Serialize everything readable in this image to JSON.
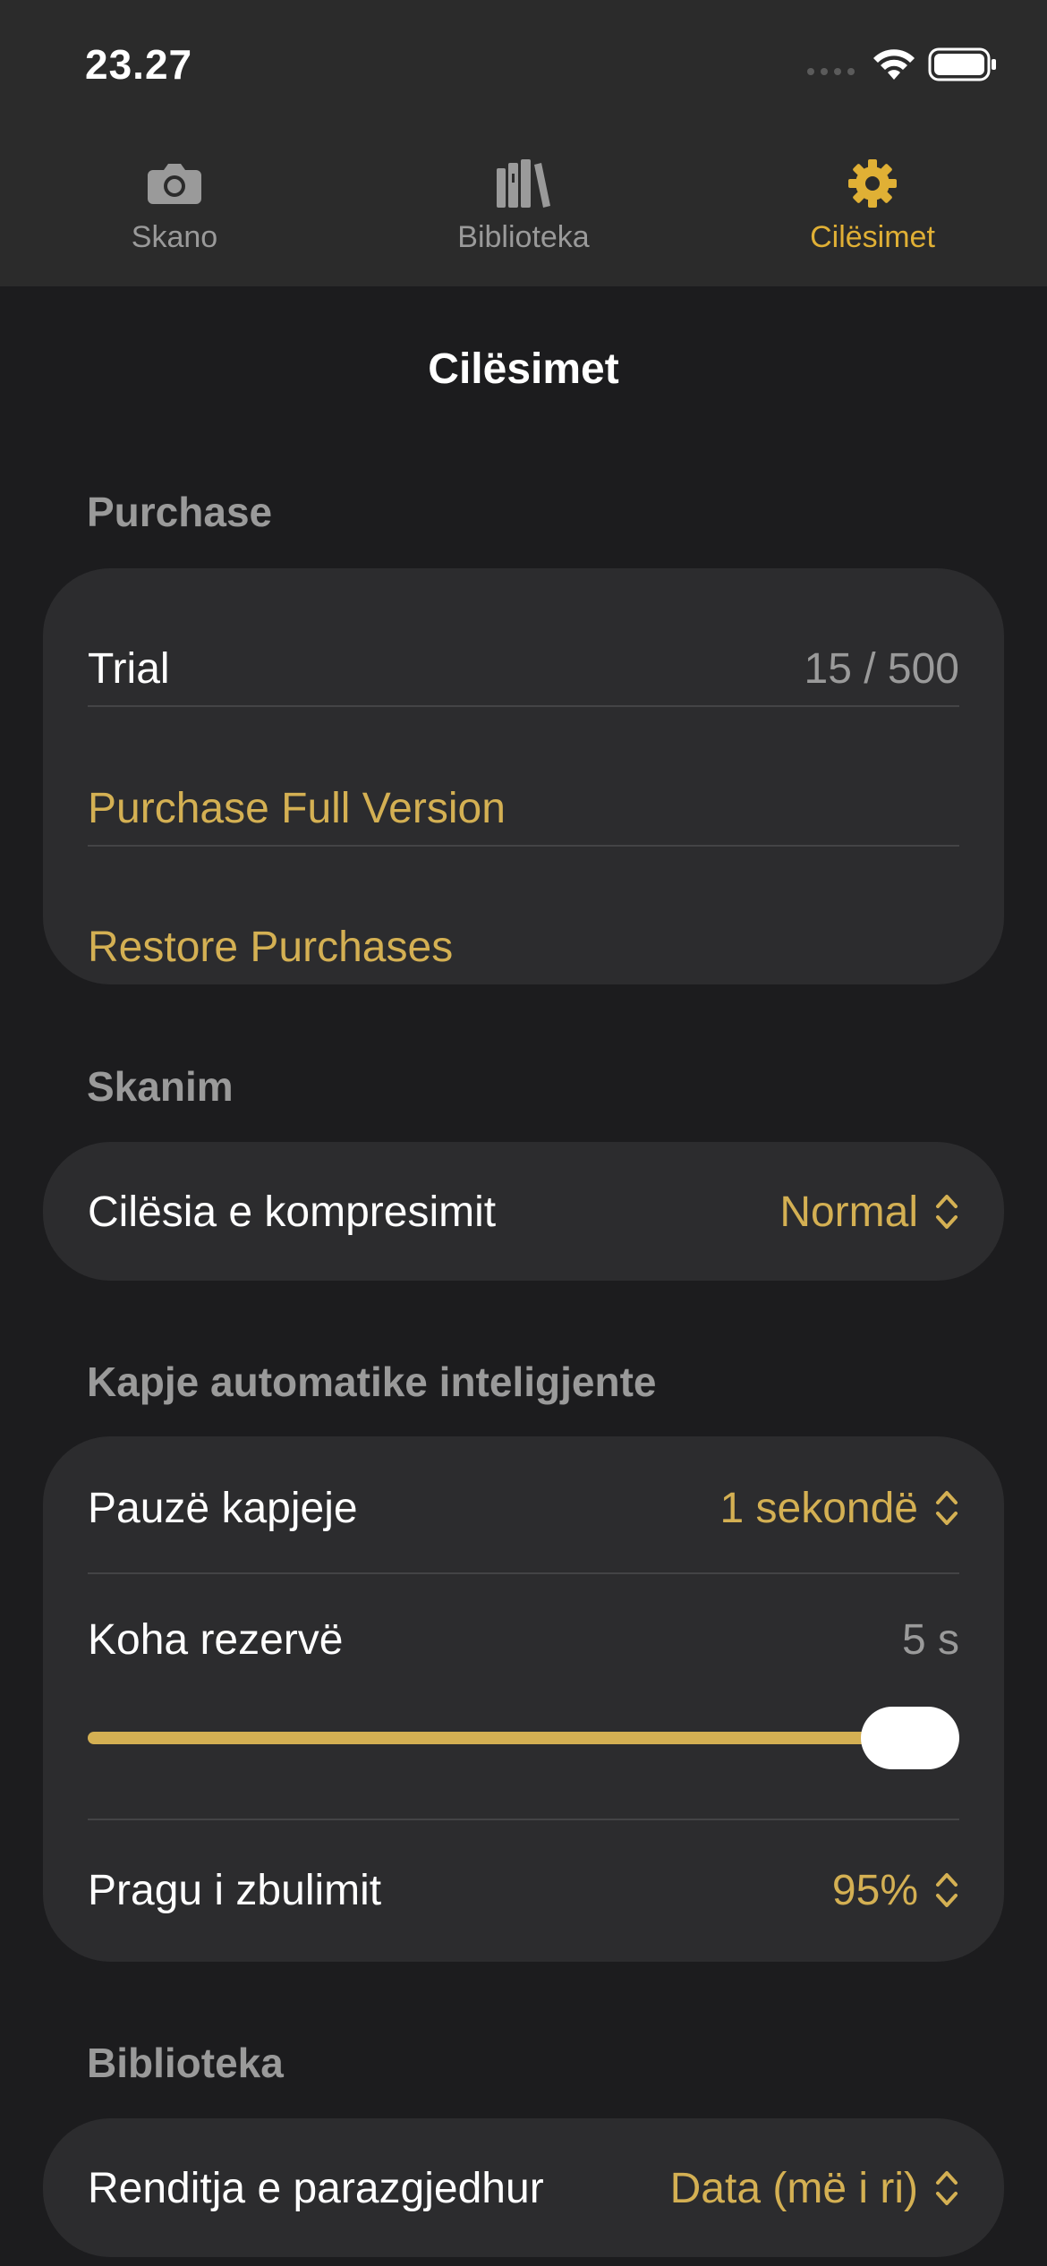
{
  "status_bar": {
    "time": "23.27"
  },
  "tabs": [
    {
      "label": "Skano",
      "icon": "camera-icon",
      "active": false
    },
    {
      "label": "Biblioteka",
      "icon": "books-icon",
      "active": false
    },
    {
      "label": "Cilësimet",
      "icon": "gear-icon",
      "active": true
    }
  ],
  "page_title": "Cilësimet",
  "sections": {
    "purchase": {
      "header": "Purchase",
      "trial_label": "Trial",
      "trial_value": "15 / 500",
      "purchase_full": "Purchase Full Version",
      "restore": "Restore Purchases"
    },
    "scan": {
      "header": "Skanim",
      "compression_label": "Cilësia e kompresimit",
      "compression_value": "Normal"
    },
    "autocapture": {
      "header": "Kapje automatike inteligjente",
      "pause_label": "Pauzë kapjeje",
      "pause_value": "1 sekondë",
      "backup_label": "Koha rezervë",
      "backup_value": "5 s",
      "backup_slider_fraction": 1.0,
      "threshold_label": "Pragu i zbulimit",
      "threshold_value": "95%"
    },
    "library": {
      "header": "Biblioteka",
      "sort_label": "Renditja e parazgjedhur",
      "sort_value": "Data (më i ri)"
    }
  },
  "colors": {
    "accent": "#d4b053",
    "tab_active": "#e0b035",
    "background": "#1c1c1e",
    "card": "#2c2c2e"
  }
}
